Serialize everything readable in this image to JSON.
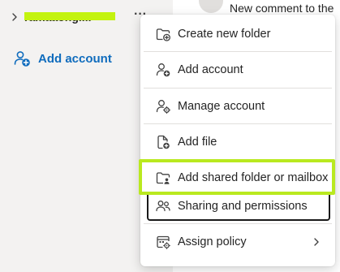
{
  "account": {
    "name": "ramaaongi..."
  },
  "left_pane": {
    "add_account_label": "Add account"
  },
  "message_list": {
    "preview": "New comment to the"
  },
  "menu": {
    "items": [
      {
        "label": "Create new folder",
        "icon": "folder-add-icon"
      },
      {
        "label": "Add account",
        "icon": "person-add-icon"
      },
      {
        "label": "Manage account",
        "icon": "person-settings-icon"
      },
      {
        "label": "Add file",
        "icon": "document-add-icon"
      },
      {
        "label": "Add shared folder or mailbox",
        "icon": "folder-person-icon"
      },
      {
        "label": "Sharing and permissions",
        "icon": "people-icon"
      },
      {
        "label": "Assign policy",
        "icon": "calendar-settings-icon"
      }
    ]
  },
  "colors": {
    "pane_bg": "#f3f2f1",
    "accent": "#0f6cbd",
    "highlight": "#b9e91f",
    "redaction": "#c3f30f"
  }
}
